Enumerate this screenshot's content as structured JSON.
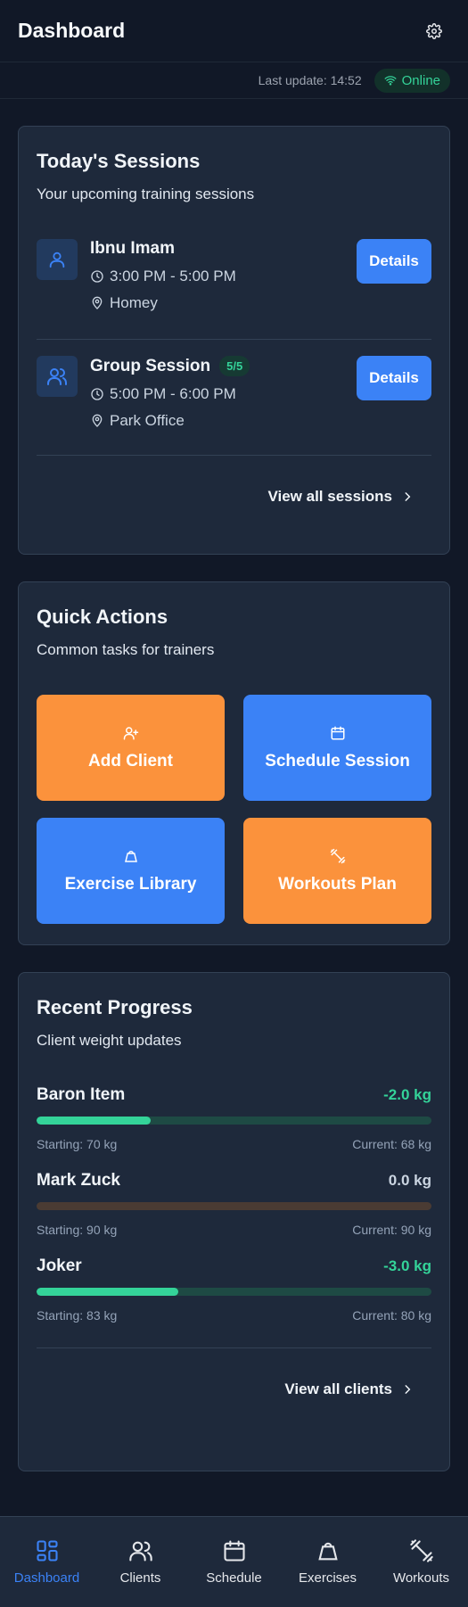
{
  "header": {
    "title": "Dashboard",
    "settings_icon": "gear-icon"
  },
  "status": {
    "last_update": "Last update: 14:52",
    "connection": "Online",
    "connection_color": "#34d399"
  },
  "sessions_card": {
    "title": "Today's Sessions",
    "subtitle": "Your upcoming training sessions",
    "sessions": [
      {
        "name": "Ibnu Imam",
        "icon": "user-icon",
        "time": "3:00 PM - 5:00 PM",
        "location": "Homey",
        "badge": "",
        "button": "Details"
      },
      {
        "name": "Group Session",
        "icon": "users-icon",
        "time": "5:00 PM - 6:00 PM",
        "location": "Park Office",
        "badge": "5/5",
        "button": "Details"
      }
    ],
    "view_all": "View all sessions"
  },
  "quick_actions": {
    "title": "Quick Actions",
    "subtitle": "Common tasks for trainers",
    "actions": [
      {
        "label": "Add Client",
        "icon": "user-plus-icon",
        "color": "#fb923c"
      },
      {
        "label": "Schedule Session",
        "icon": "calendar-icon",
        "color": "#3b82f6"
      },
      {
        "label": "Exercise Library",
        "icon": "kettlebell-icon",
        "color": "#3b82f6"
      },
      {
        "label": "Workouts Plan",
        "icon": "dumbbell-icon",
        "color": "#fb923c"
      }
    ]
  },
  "progress": {
    "title": "Recent Progress",
    "subtitle": "Client weight updates",
    "clients": [
      {
        "name": "Baron Item",
        "change": "-2.0 kg",
        "starting": "Starting: 70 kg",
        "current": "Current: 68 kg",
        "progress": 0.29,
        "change_color": "#34d399",
        "track_color": "#1e4a44"
      },
      {
        "name": "Mark Zuck",
        "change": "0.0 kg",
        "starting": "Starting: 90 kg",
        "current": "Current: 90 kg",
        "progress": 0,
        "change_color": "#cbd5e1",
        "track_color": "#4a3b33"
      },
      {
        "name": "Joker",
        "change": "-3.0 kg",
        "starting": "Starting: 83 kg",
        "current": "Current: 80 kg",
        "progress": 0.36,
        "change_color": "#34d399",
        "track_color": "#1e4a44"
      }
    ],
    "view_all": "View all clients"
  },
  "nav": {
    "items": [
      {
        "label": "Dashboard",
        "icon": "dashboard-icon",
        "active": true
      },
      {
        "label": "Clients",
        "icon": "users-icon",
        "active": false
      },
      {
        "label": "Schedule",
        "icon": "calendar-icon",
        "active": false
      },
      {
        "label": "Exercises",
        "icon": "kettlebell-icon",
        "active": false
      },
      {
        "label": "Workouts",
        "icon": "dumbbell-icon",
        "active": false
      }
    ]
  }
}
